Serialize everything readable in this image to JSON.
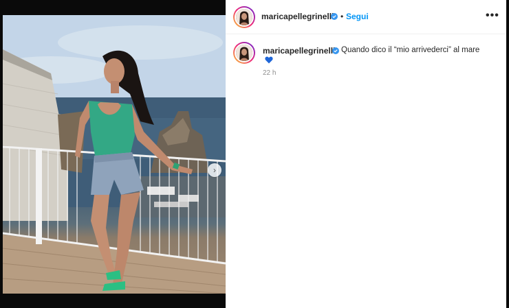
{
  "post": {
    "media": {
      "alt": "",
      "carousel": {
        "count": 2,
        "current": 1
      },
      "next_icon": "chevron-right-icon"
    },
    "header": {
      "username": "maricapellegrinelli",
      "verified_icon": "verified-badge-icon",
      "separator": "•",
      "follow_label": "Segui",
      "more_icon": "more-horizontal-icon",
      "more_glyph": "•••"
    },
    "caption": {
      "username": "maricapellegrinelli",
      "verified_icon": "verified-badge-icon",
      "text": "Quando dico il “mio arrivederci” al mare",
      "emoji_icon": "blue-heart-icon",
      "time": "22 h"
    },
    "colors": {
      "link": "#0095f6",
      "verified": "#3897f0",
      "heart": "#1e66d8",
      "text": "#262626",
      "muted": "#8e8e8e"
    }
  }
}
